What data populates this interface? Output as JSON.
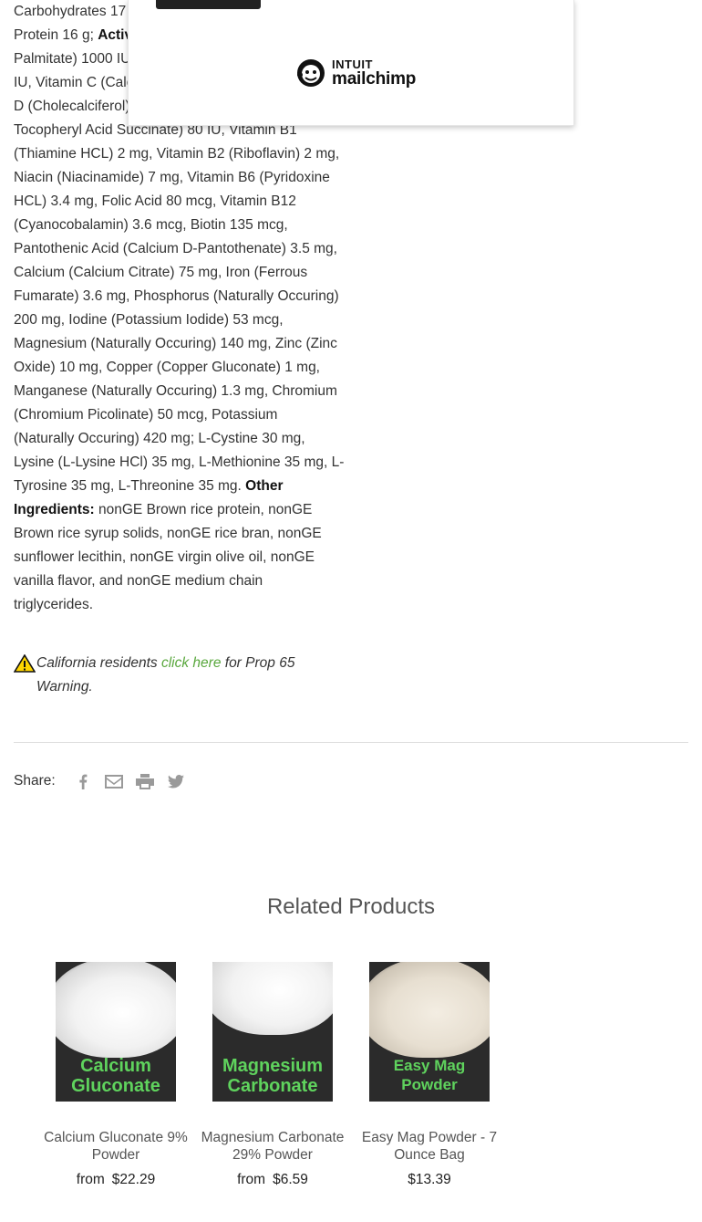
{
  "description": {
    "lines": [
      {
        "segments": [
          {
            "text": "Carbohydrates 17",
            "bold": false
          }
        ]
      },
      {
        "segments": [
          {
            "text": "Protein 16 g; ",
            "bold": false
          },
          {
            "text": "Activ",
            "bold": true
          }
        ]
      },
      {
        "segments": [
          {
            "text": "Palmitate) 1000 IU",
            "bold": false
          }
        ]
      },
      {
        "segments": [
          {
            "text": "IU, Vitamin C (Calc",
            "bold": false
          }
        ]
      },
      {
        "segments": [
          {
            "text": "D (Cholecalciferol)",
            "bold": false
          }
        ]
      },
      {
        "segments": [
          {
            "text": "Tocopheryl Acid Succinate) 80 IU, Vitamin B1",
            "bold": false
          }
        ]
      },
      {
        "segments": [
          {
            "text": "(Thiamine HCL) 2 mg, Vitamin B2 (Riboflavin) 2 mg,",
            "bold": false
          }
        ]
      },
      {
        "segments": [
          {
            "text": "Niacin (Niacinamide) 7 mg, Vitamin B6 (Pyridoxine",
            "bold": false
          }
        ]
      },
      {
        "segments": [
          {
            "text": "HCL) 3.4 mg, Folic Acid 80 mcg, Vitamin B12",
            "bold": false
          }
        ]
      },
      {
        "segments": [
          {
            "text": "(Cyanocobalamin) 3.6 mcg, Biotin 135 mcg,",
            "bold": false
          }
        ]
      },
      {
        "segments": [
          {
            "text": "Pantothenic Acid (Calcium D-Pantothenate) 3.5 mg,",
            "bold": false
          }
        ]
      },
      {
        "segments": [
          {
            "text": "Calcium (Calcium Citrate) 75 mg, Iron (Ferrous",
            "bold": false
          }
        ]
      },
      {
        "segments": [
          {
            "text": "Fumarate) 3.6 mg, Phosphorus (Naturally Occuring)",
            "bold": false
          }
        ]
      },
      {
        "segments": [
          {
            "text": "200 mg, Iodine (Potassium Iodide) 53 mcg,",
            "bold": false
          }
        ]
      },
      {
        "segments": [
          {
            "text": "Magnesium (Naturally Occuring) 140 mg, Zinc (Zinc",
            "bold": false
          }
        ]
      },
      {
        "segments": [
          {
            "text": "Oxide) 10 mg, Copper (Copper Gluconate) 1 mg,",
            "bold": false
          }
        ]
      },
      {
        "segments": [
          {
            "text": "Manganese (Naturally Occuring) 1.3 mg, Chromium",
            "bold": false
          }
        ]
      },
      {
        "segments": [
          {
            "text": "(Chromium Picolinate) 50 mcg, Potassium",
            "bold": false
          }
        ]
      },
      {
        "segments": [
          {
            "text": "(Naturally Occuring) 420 mg; L-Cystine 30 mg,",
            "bold": false
          }
        ]
      },
      {
        "segments": [
          {
            "text": "Lysine (L-Lysine HCl) 35 mg, L-Methionine 35 mg, L-",
            "bold": false
          }
        ]
      },
      {
        "segments": [
          {
            "text": "Tyrosine 35 mg, L-Threonine 35 mg. ",
            "bold": false
          },
          {
            "text": "Other",
            "bold": true
          }
        ]
      },
      {
        "segments": [
          {
            "text": "Ingredients:",
            "bold": true
          },
          {
            "text": " nonGE Brown rice protein, nonGE",
            "bold": false
          }
        ]
      },
      {
        "segments": [
          {
            "text": "Brown rice syrup solids, nonGE rice bran, nonGE",
            "bold": false
          }
        ]
      },
      {
        "segments": [
          {
            "text": "sunflower lecithin, nonGE virgin olive oil, nonGE",
            "bold": false
          }
        ]
      },
      {
        "segments": [
          {
            "text": "vanilla flavor, and nonGE medium chain",
            "bold": false
          }
        ]
      },
      {
        "segments": [
          {
            "text": "triglycerides.",
            "bold": false
          }
        ]
      }
    ]
  },
  "popup": {
    "logo_top": "INTUIT",
    "logo_bottom": "mailchimp"
  },
  "prop65": {
    "icon": "warning-icon",
    "before": "California residents ",
    "link": "click here",
    "after": " for Prop 65 Warning."
  },
  "share": {
    "label": "Share:",
    "icons": [
      "facebook-icon",
      "email-icon",
      "print-icon",
      "twitter-icon"
    ]
  },
  "related": {
    "title": "Related Products",
    "products": [
      {
        "image_label": "Calcium Gluconate",
        "name": "Calcium Gluconate 9% Powder",
        "from": "from",
        "price": "$22.29"
      },
      {
        "image_label": "Magnesium Carbonate",
        "name": "Magnesium Carbonate 29% Powder",
        "from": "from",
        "price": "$6.59"
      },
      {
        "image_label": "Easy Mag Powder",
        "name": "Easy Mag Powder - 7 Ounce Bag",
        "from": "",
        "price": "$13.39"
      }
    ]
  },
  "colors": {
    "link_green": "#5aa83e",
    "label_green": "#5fd35d",
    "icon_gray": "#9a9a9a"
  }
}
